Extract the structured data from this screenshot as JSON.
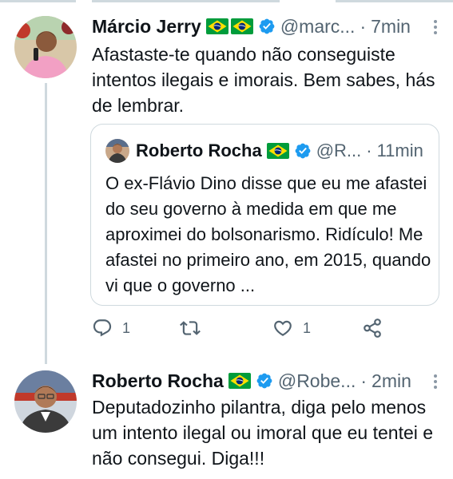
{
  "tweets": [
    {
      "name": "Márcio Jerry",
      "flags": 2,
      "handle": "@marc...",
      "dot": "·",
      "time": "7min",
      "text": "Afastaste-te quando não conseguiste intentos ilegais e imorais. Bem sabes, hás de lembrar.",
      "quote": {
        "name": "Roberto Rocha",
        "handle": "@R...",
        "dot": "·",
        "time": "11min",
        "text": "O ex-Flávio Dino disse que eu me afastei do seu governo à medida em que me aproximei do bolsonarismo. Ridículo! Me afastei no primeiro ano, em 2015, quando vi que o governo ..."
      },
      "actions": {
        "reply_count": "1",
        "retweet_count": "",
        "like_count": "1"
      }
    },
    {
      "name": "Roberto Rocha",
      "flags": 1,
      "handle": "@Robe...",
      "dot": "·",
      "time": "2min",
      "text": "Deputadozinho pilantra, diga pelo menos um intento ilegal ou imoral que eu tentei e não consegui. Diga!!!"
    }
  ],
  "icons": {
    "reply": "reply-icon",
    "retweet": "retweet-icon",
    "like": "like-icon",
    "share": "share-icon",
    "more": "more-options-icon",
    "verified": "verified-badge-icon",
    "flag": "brazil-flag-icon"
  },
  "colors": {
    "text_primary": "#0f1419",
    "text_secondary": "#536471",
    "verified_blue": "#1d9bf0",
    "border": "#cfd9de",
    "flag_green": "#009c3b",
    "flag_yellow": "#ffdf00",
    "flag_blue": "#002776"
  }
}
